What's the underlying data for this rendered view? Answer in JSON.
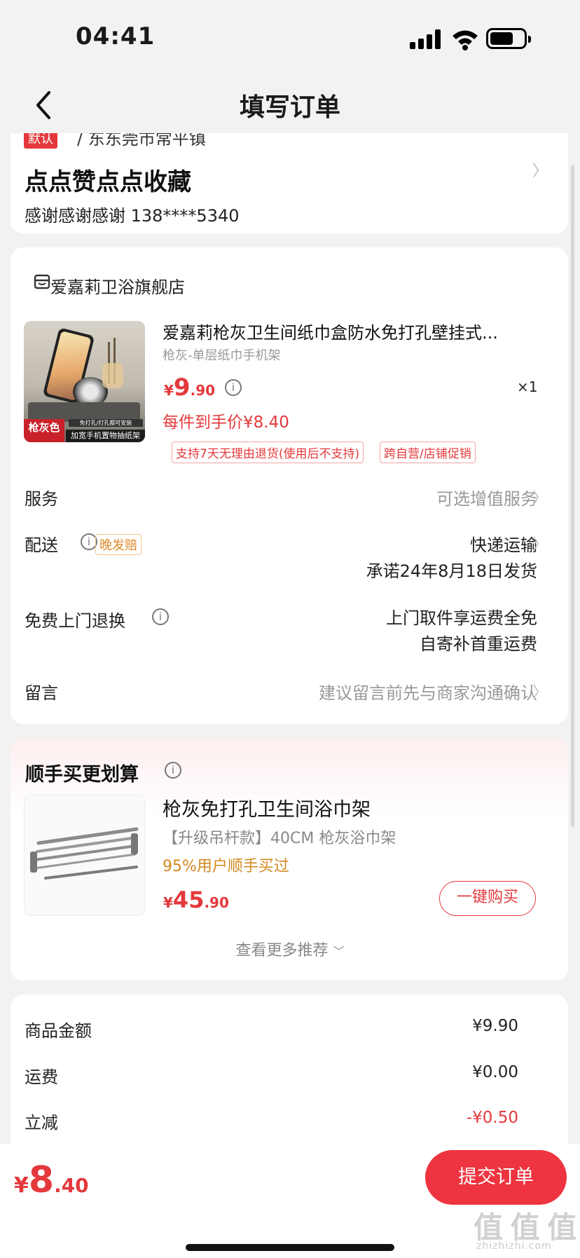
{
  "status_bar": {
    "time": "04:41"
  },
  "nav": {
    "title": "填写订单"
  },
  "address": {
    "default_tag": "默认",
    "region": "/ 东东莞市常平镇",
    "name": "点点赞点点收藏",
    "contact": "感谢感谢感谢  138****5340"
  },
  "store": {
    "name": "爱嘉莉卫浴旗舰店"
  },
  "product": {
    "title": "爱嘉莉枪灰卫生间纸巾盒防水免打孔壁挂式...",
    "spec": "枪灰-单层纸巾手机架",
    "currency": "¥",
    "price_int": "9",
    "price_dec": ".90",
    "qty": "×1",
    "final_price": "每件到手价¥8.40",
    "chips": [
      "支持7天无理由退货(使用后不支持)",
      "跨自营/店铺促销"
    ],
    "image_label": "枪灰色",
    "image_caption": "加宽手机置物抽纸架",
    "image_badge": "免打孔/打孔都可安装"
  },
  "rows": {
    "service_label": "服务",
    "service_value": "可选增值服务",
    "delivery_label": "配送",
    "delivery_tag": "晚发赔",
    "delivery_method": "快递运输",
    "delivery_promise": "承诺24年8月18日发货",
    "return_label": "免费上门退换",
    "return_value_1": "上门取件享运费全免",
    "return_value_2": "自寄补首重运费",
    "note_label": "留言",
    "note_placeholder": "建议留言前先与商家沟通确认"
  },
  "recommend": {
    "title": "顺手买更划算",
    "name": "枪灰免打孔卫生间浴巾架",
    "spec": "【升级吊杆款】40CM 枪灰浴巾架",
    "bought": "95%用户顺手买过",
    "currency": "¥",
    "price_int": "45",
    "price_dec": ".90",
    "buy_label": "一键购买",
    "more_label": "查看更多推荐"
  },
  "summary": {
    "goods_label": "商品金额",
    "goods_value": "¥9.90",
    "shipping_label": "运费",
    "shipping_value": "¥0.00",
    "discount_label": "立减",
    "discount_value": "-¥0.50"
  },
  "bottom": {
    "currency": "¥",
    "total_int": "8",
    "total_dec": ".40",
    "submit_label": "提交订单",
    "watermark": "值 值 值",
    "watermark_sub": "zhizhizhi.com"
  },
  "colors": {
    "accent": "#e4393c",
    "submit": "#ee3440",
    "orange": "#d4891f"
  }
}
